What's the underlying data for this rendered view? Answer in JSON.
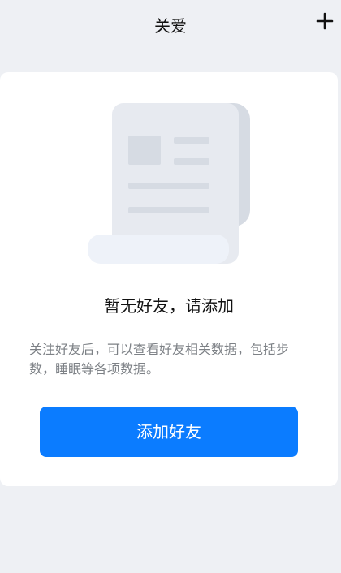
{
  "header": {
    "title": "关爱",
    "add_icon": "plus-icon"
  },
  "empty_state": {
    "illustration": "document-scroll-illustration",
    "title": "暂无好友，请添加",
    "description": "关注好友后，可以查看好友相关数据，包括步数，睡眠等各项数据。",
    "button_label": "添加好友"
  },
  "colors": {
    "background": "#eef0f4",
    "card": "#ffffff",
    "primary_button": "#0b7cff",
    "text_primary": "#111111",
    "text_secondary": "#7d8186"
  }
}
